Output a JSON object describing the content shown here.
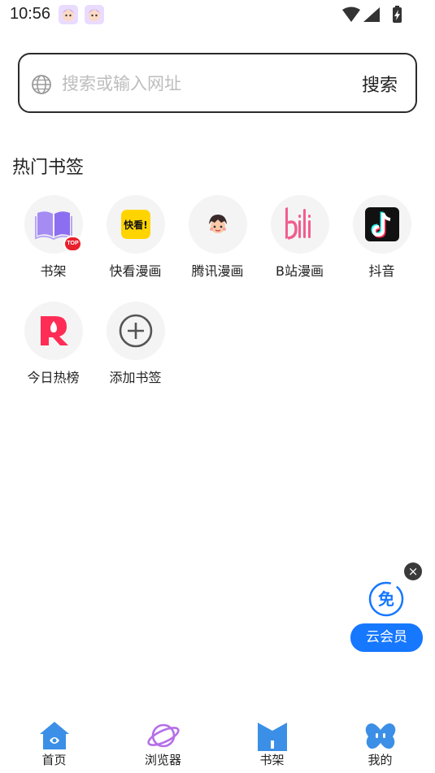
{
  "status_bar": {
    "time": "10:56",
    "icons": [
      "notification-avatar",
      "notification-avatar",
      "wifi-icon",
      "signal-icon",
      "battery-charging-icon"
    ]
  },
  "search": {
    "placeholder": "搜索或输入网址",
    "value": "",
    "button_label": "搜索",
    "icon": "globe-icon"
  },
  "hot_bookmarks": {
    "title": "热门书签",
    "items": [
      {
        "label": "书架",
        "icon": "book-icon",
        "badge": "TOP",
        "color": "#9b7cf0"
      },
      {
        "label": "快看漫画",
        "icon": "kuaikan-logo-icon",
        "logo_text": "快看!",
        "color": "#ffd400"
      },
      {
        "label": "腾讯漫画",
        "icon": "tencent-comic-logo-icon",
        "color": "#f4a07a"
      },
      {
        "label": "B站漫画",
        "icon": "bilibili-logo-icon",
        "color": "#f25d8e"
      },
      {
        "label": "抖音",
        "icon": "douyin-logo-icon",
        "color": "#111111"
      },
      {
        "label": "今日热榜",
        "icon": "hot-list-logo-icon",
        "color": "#ff2d55"
      },
      {
        "label": "添加书签",
        "icon": "add-circle-icon",
        "color": "#555555"
      }
    ]
  },
  "vip_float": {
    "icon_text": "免",
    "button_label": "云会员",
    "accent": "#1677ff",
    "close_icon": "close-icon"
  },
  "bottom_nav": {
    "items": [
      {
        "label": "首页",
        "icon": "home-icon",
        "active": true,
        "color": "#3b8fe6"
      },
      {
        "label": "浏览器",
        "icon": "planet-icon",
        "active": false,
        "color": "#b56ee8"
      },
      {
        "label": "书架",
        "icon": "bookshelf-icon",
        "active": false,
        "color": "#3b8fe6"
      },
      {
        "label": "我的",
        "icon": "butterfly-icon",
        "active": false,
        "color": "#3b8fe6"
      }
    ]
  }
}
